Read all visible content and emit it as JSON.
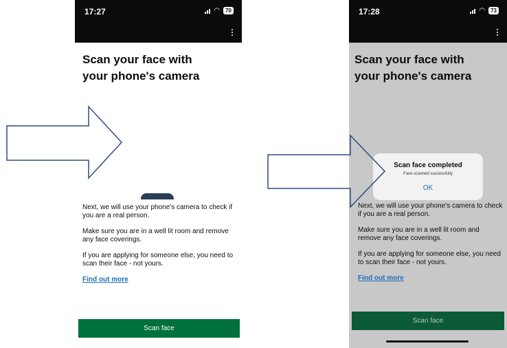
{
  "left_phone": {
    "time": "17:27",
    "battery": "70",
    "title": "Scan your face with your phone's camera",
    "paragraphs": [
      "Next, we will use your phone's camera to check if you are a real person.",
      "Make sure you are in a well lit room and remove any face coverings.",
      "If you are applying for someone else, you need to scan their face - not yours."
    ],
    "link": "Find out more",
    "button": "Scan face"
  },
  "right_phone": {
    "time": "17:28",
    "battery": "73",
    "title": "Scan your face with your phone's camera",
    "paragraphs": [
      "Next, we will use your phone's camera to check if you are a real person.",
      "Make sure you are in a well lit room and remove any face coverings.",
      "If you are applying for someone else, you need to scan their face - not yours."
    ],
    "link": "Find out more",
    "button": "Scan face",
    "dialog": {
      "title": "Scan face completed",
      "message": "Face scanned successfully",
      "ok": "OK"
    }
  },
  "colors": {
    "button_green": "#00703c",
    "link_blue": "#1d70b8",
    "arrow_stroke": "#2f4b7c",
    "overlay_gray": "#c8c8c8"
  }
}
